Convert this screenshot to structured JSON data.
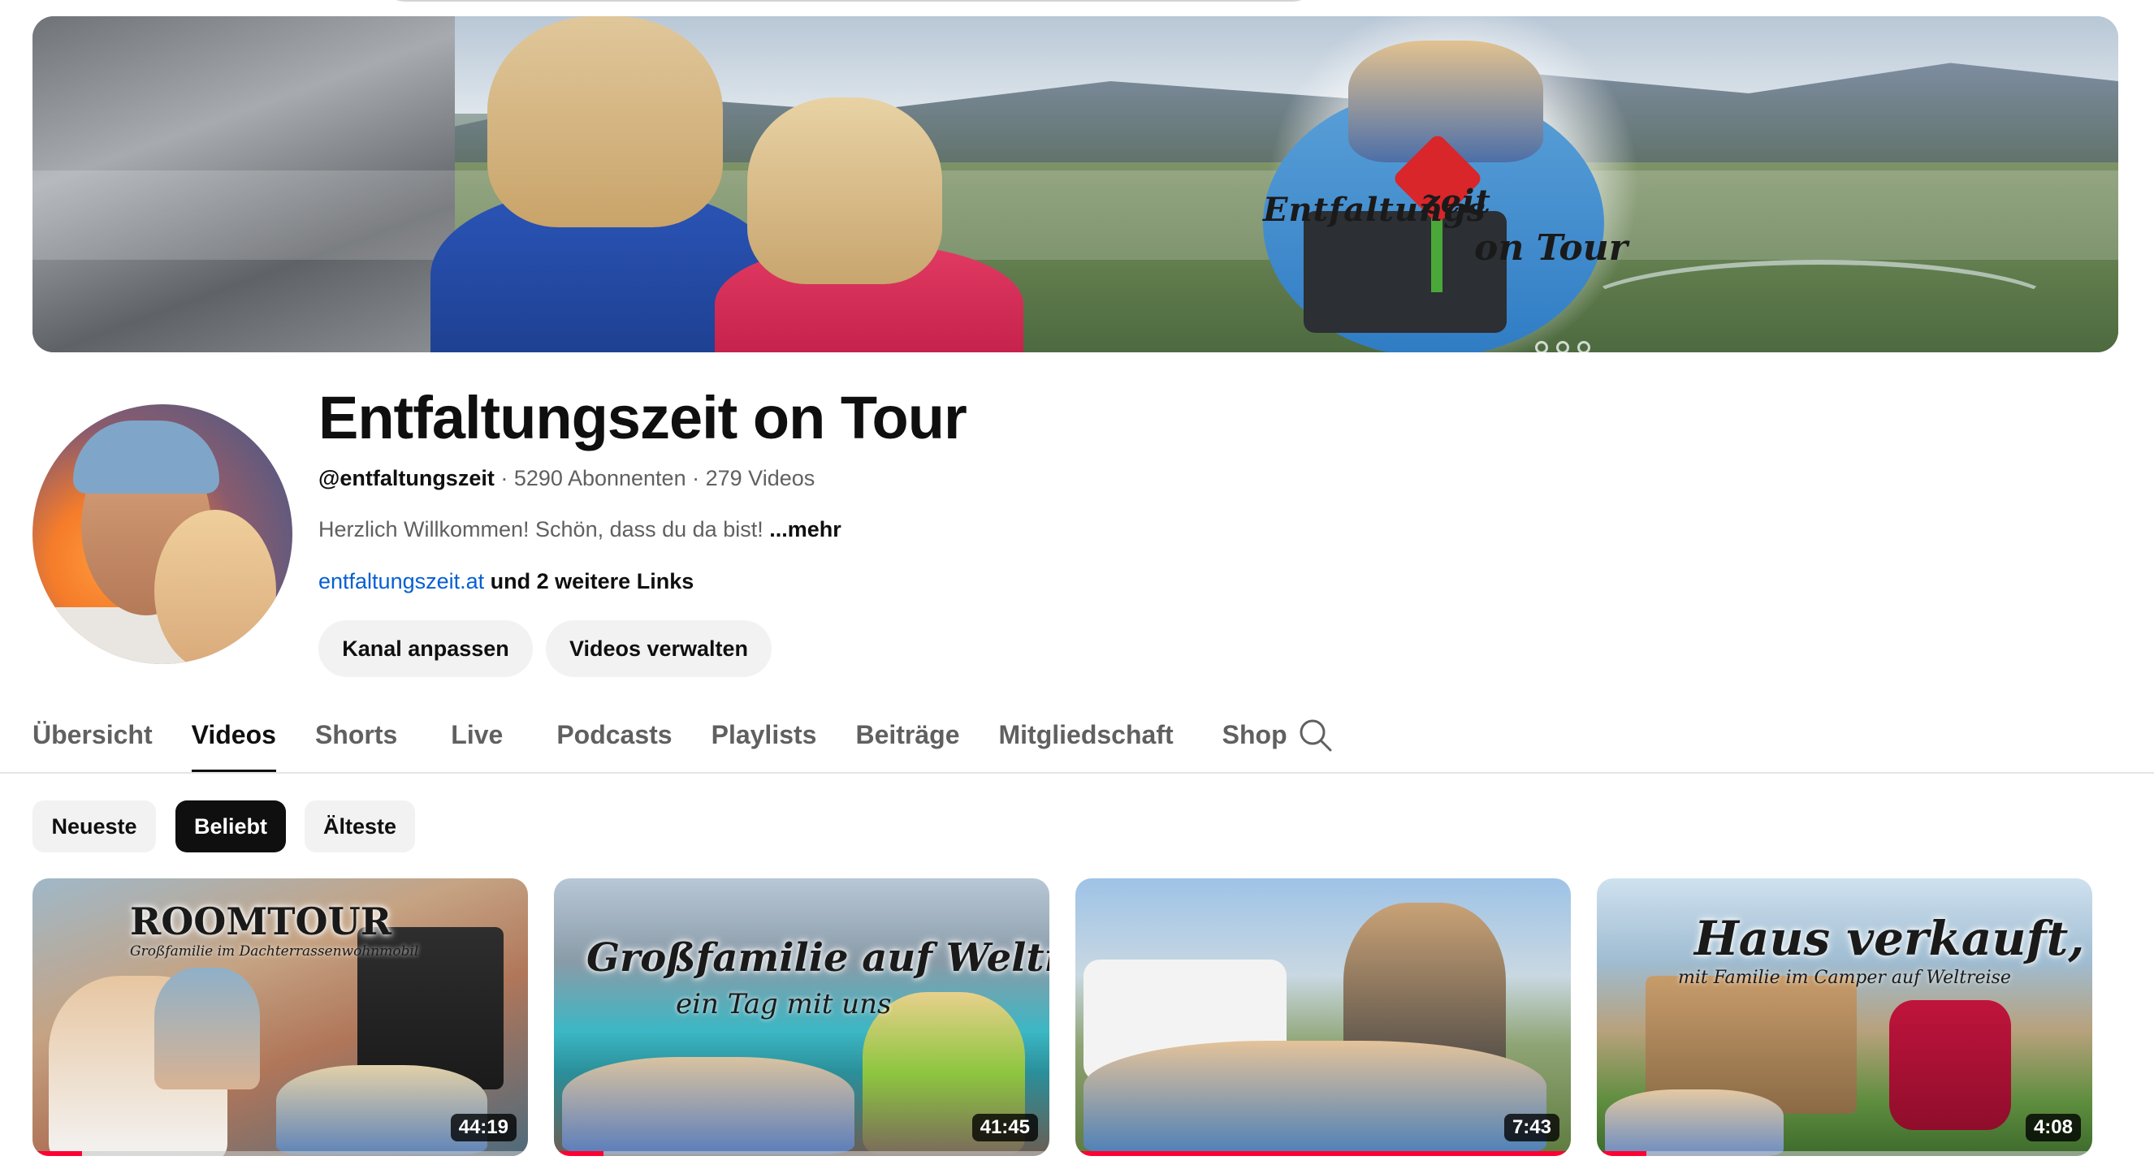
{
  "banner": {
    "logo_text_1": "Entfaltungs",
    "logo_text_2": "zeit",
    "logo_text_3": "on Tour"
  },
  "channel": {
    "name": "Entfaltungszeit on Tour",
    "handle": "@entfaltungszeit",
    "subscribers": "5290 Abonnenten",
    "videos": "279 Videos",
    "separator": "·",
    "description": "Herzlich Willkommen! Schön, dass du da bist!",
    "more_label": "...mehr",
    "link": "entfaltungszeit.at",
    "more_links": "und 2 weitere Links",
    "customize_button": "Kanal anpassen",
    "manage_button": "Videos verwalten"
  },
  "tabs": [
    {
      "label": "Übersicht"
    },
    {
      "label": "Videos"
    },
    {
      "label": "Shorts"
    },
    {
      "label": "Live"
    },
    {
      "label": "Podcasts"
    },
    {
      "label": "Playlists"
    },
    {
      "label": "Beiträge"
    },
    {
      "label": "Mitgliedschaft"
    },
    {
      "label": "Shop"
    }
  ],
  "active_tab": "Videos",
  "chips": [
    {
      "label": "Neueste"
    },
    {
      "label": "Beliebt"
    },
    {
      "label": "Älteste"
    }
  ],
  "active_chip": "Beliebt",
  "videos": [
    {
      "title_art": "ROOMTOUR",
      "subtitle_art": "Großfamilie im Dachterrassenwohnmobil",
      "duration": "44:19",
      "watched": 0.1
    },
    {
      "title_art": "Großfamilie auf Weltreise",
      "subtitle_art": "ein Tag mit uns",
      "duration": "41:45",
      "watched": 0.1
    },
    {
      "title_art": "",
      "subtitle_art": "",
      "duration": "7:43",
      "watched": 1.0
    },
    {
      "title_art": "Haus verkauft,",
      "subtitle_art": "mit Familie im Camper auf Weltreise",
      "duration": "4:08",
      "watched": 0.1
    }
  ],
  "colors": {
    "accent_red": "#ff0033",
    "link_blue": "#065fd4",
    "chip_active": "#0f0f0f",
    "chip_bg": "#f2f2f2"
  },
  "icons": {
    "tab_search": "search-icon"
  }
}
